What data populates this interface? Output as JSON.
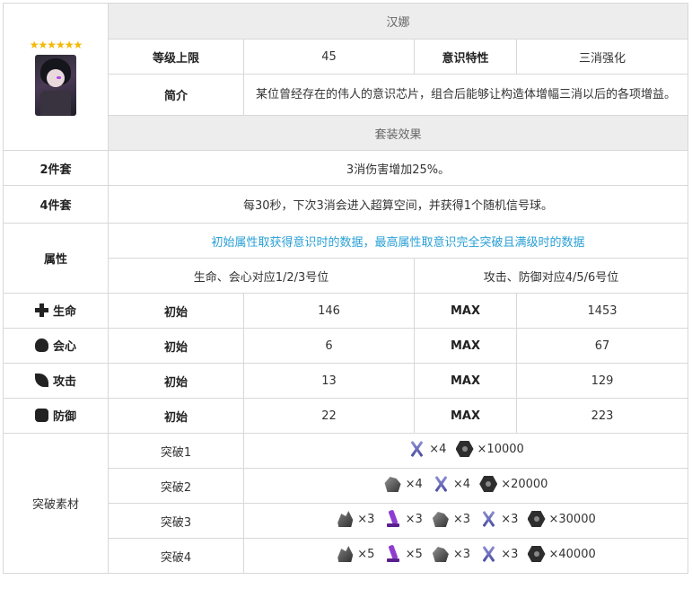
{
  "card": {
    "stars": "★★★★★★",
    "portrait_icon": "character-portrait",
    "name": "汉娜",
    "level_cap_label": "等级上限",
    "level_cap_value": "45",
    "trait_label": "意识特性",
    "trait_value": "三消强化",
    "intro_label": "简介",
    "intro_text": "某位曾经存在的伟人的意识芯片，组合后能够让构造体增幅三消以后的各项增益。"
  },
  "set": {
    "header": "套装效果",
    "two_label": "2件套",
    "two_text": "3消伤害增加25%。",
    "four_label": "4件套",
    "four_text": "每30秒，下次3消会进入超算空间，并获得1个随机信号球。"
  },
  "attr": {
    "label": "属性",
    "note": "初始属性取获得意识时的数据，最高属性取意识完全突破且满级时的数据",
    "left_header": "生命、会心对应1/2/3号位",
    "right_header": "攻击、防御对应4/5/6号位",
    "rows": [
      {
        "icon": "plus-icon",
        "label": "生命",
        "init_label": "初始",
        "init": "146",
        "max_label": "MAX",
        "max": "1453"
      },
      {
        "icon": "skull-icon",
        "label": "会心",
        "init_label": "初始",
        "init": "6",
        "max_label": "MAX",
        "max": "67"
      },
      {
        "icon": "leaf-icon",
        "label": "攻击",
        "init_label": "初始",
        "init": "13",
        "max_label": "MAX",
        "max": "129"
      },
      {
        "icon": "shield-icon",
        "label": "防御",
        "init_label": "初始",
        "init": "22",
        "max_label": "MAX",
        "max": "223"
      }
    ]
  },
  "breakthrough": {
    "label": "突破素材",
    "rows": [
      {
        "label": "突破1",
        "items": [
          {
            "icon": "cross-blade",
            "qty": "×4"
          },
          {
            "icon": "hex-nut",
            "qty": "×10000"
          }
        ]
      },
      {
        "label": "突破2",
        "items": [
          {
            "icon": "ore-chunk",
            "qty": "×4"
          },
          {
            "icon": "cross-blade",
            "qty": "×4"
          },
          {
            "icon": "hex-nut",
            "qty": "×20000"
          }
        ]
      },
      {
        "label": "突破3",
        "items": [
          {
            "icon": "rock-cluster",
            "qty": "×3"
          },
          {
            "icon": "purple-vial",
            "qty": "×3"
          },
          {
            "icon": "ore-chunk",
            "qty": "×3"
          },
          {
            "icon": "cross-blade",
            "qty": "×3"
          },
          {
            "icon": "hex-nut",
            "qty": "×30000"
          }
        ]
      },
      {
        "label": "突破4",
        "items": [
          {
            "icon": "rock-cluster",
            "qty": "×5"
          },
          {
            "icon": "purple-vial",
            "qty": "×5"
          },
          {
            "icon": "ore-chunk",
            "qty": "×3"
          },
          {
            "icon": "cross-blade",
            "qty": "×3"
          },
          {
            "icon": "hex-nut",
            "qty": "×40000"
          }
        ]
      }
    ]
  }
}
